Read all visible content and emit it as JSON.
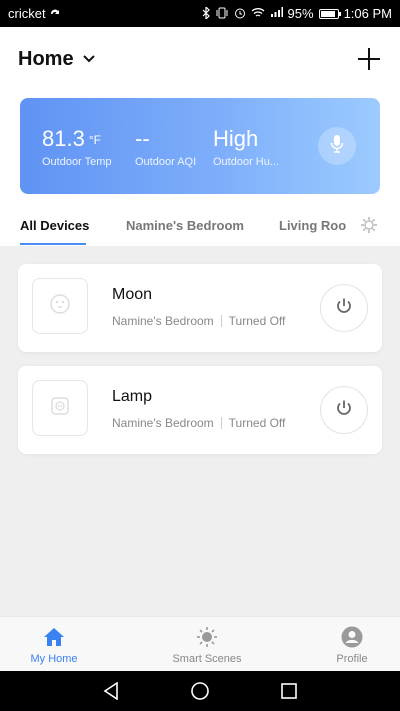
{
  "status_bar": {
    "carrier": "cricket",
    "battery": "95%",
    "battery_level": 0.95,
    "time": "1:06 PM"
  },
  "header": {
    "title": "Home"
  },
  "weather": {
    "temp_value": "81.3",
    "temp_unit": "°F",
    "temp_label": "Outdoor Temp",
    "aqi_value": "--",
    "aqi_label": "Outdoor AQI",
    "humidity_value": "High",
    "humidity_label": "Outdoor Hu..."
  },
  "tabs": [
    {
      "label": "All Devices"
    },
    {
      "label": "Namine's Bedroom"
    },
    {
      "label": "Living Roor"
    }
  ],
  "devices": [
    {
      "name": "Moon",
      "room": "Namine's Bedroom",
      "status": "Turned Off"
    },
    {
      "name": "Lamp",
      "room": "Namine's Bedroom",
      "status": "Turned Off"
    }
  ],
  "bottom_nav": [
    {
      "label": "My Home",
      "icon": "home-icon"
    },
    {
      "label": "Smart Scenes",
      "icon": "sun-icon"
    },
    {
      "label": "Profile",
      "icon": "profile-icon"
    }
  ],
  "colors": {
    "accent": "#3a82f0",
    "card_gradient_start": "#5f93f4",
    "card_gradient_end": "#9ccbff"
  }
}
